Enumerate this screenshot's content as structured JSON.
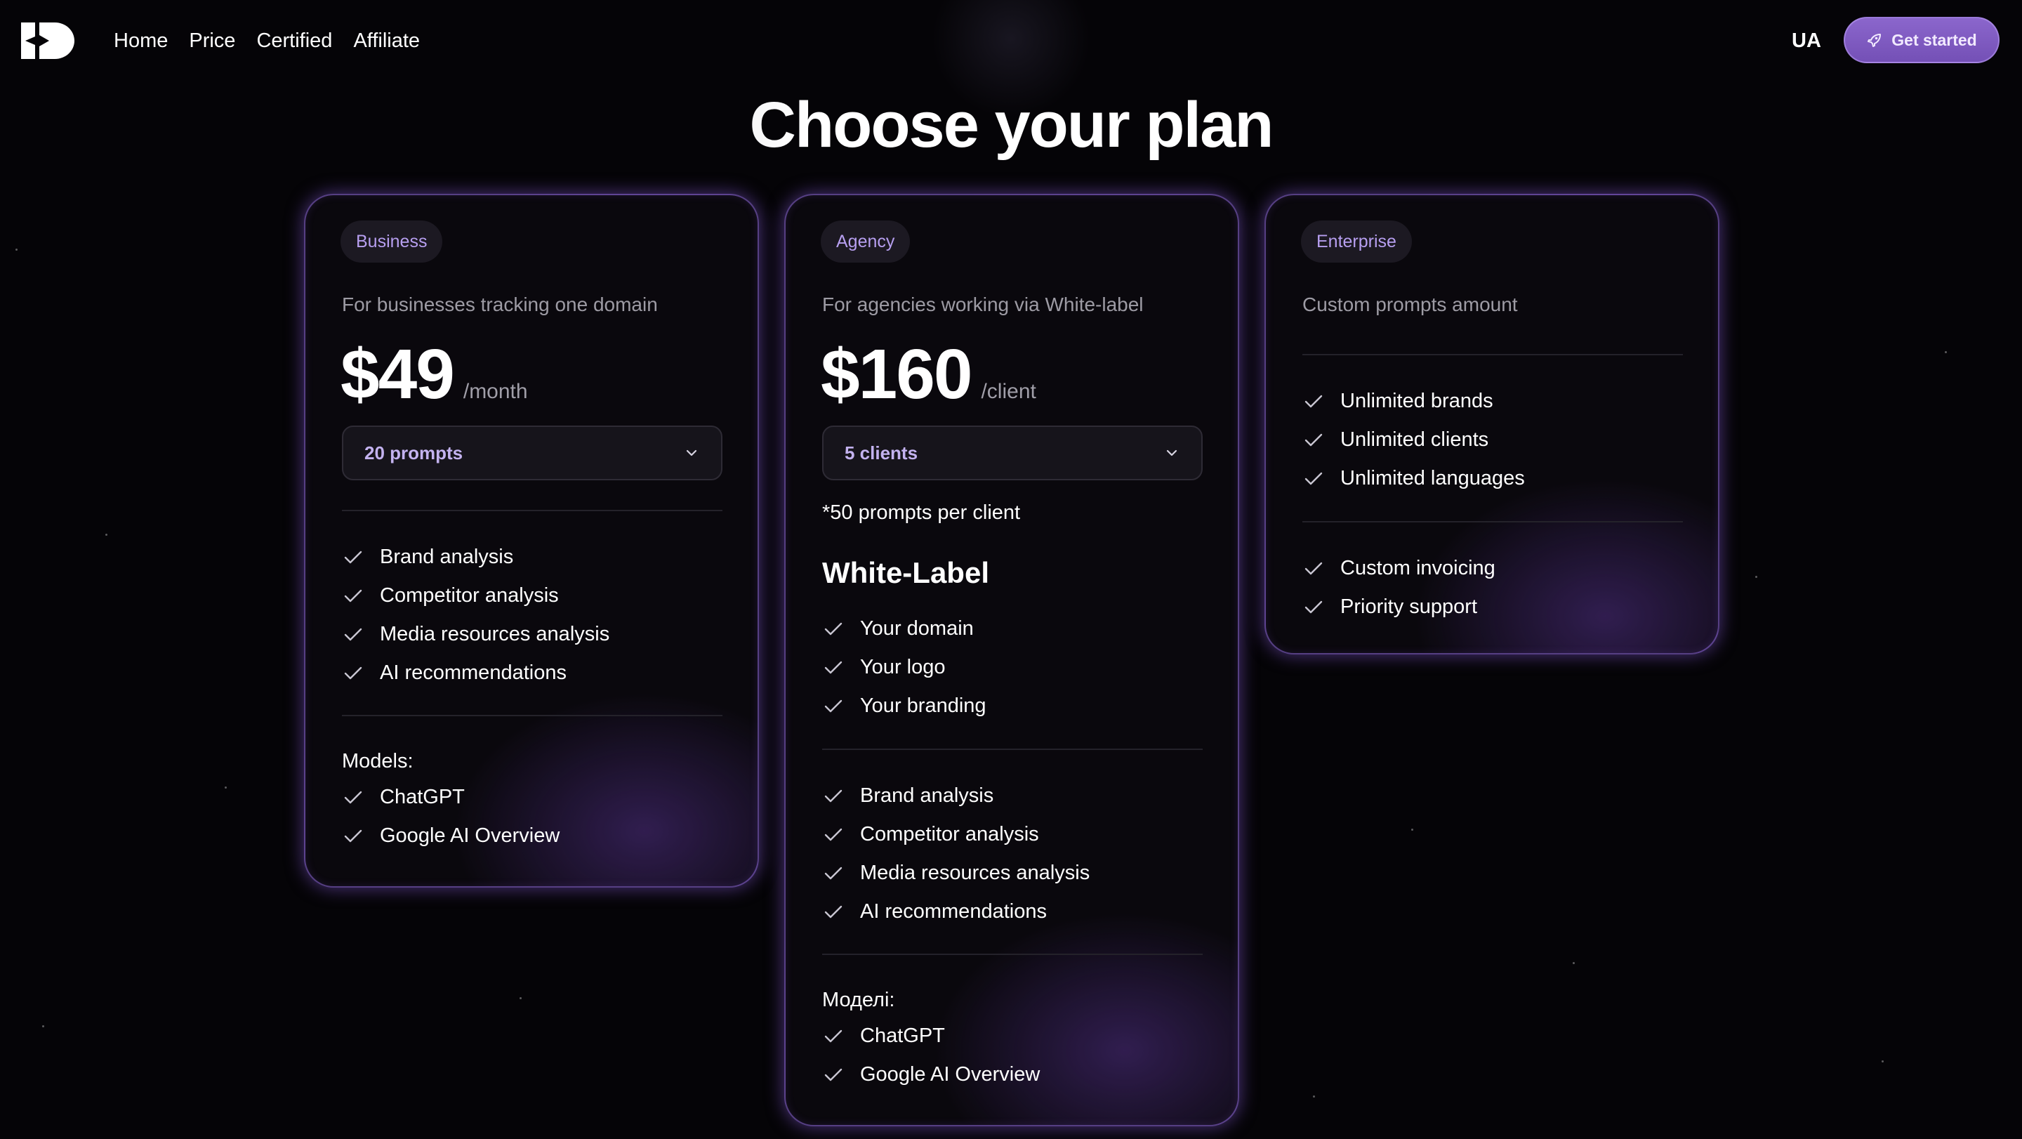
{
  "nav": {
    "links": [
      "Home",
      "Price",
      "Certified",
      "Affiliate"
    ],
    "lang": "UA",
    "cta_label": "Get started"
  },
  "page": {
    "title": "Choose your plan"
  },
  "colors": {
    "accent": "#8b66cc",
    "badge_text": "#b79ff0",
    "card_glow": "#8c5fe6",
    "background": "#050407"
  },
  "plans": {
    "business": {
      "badge": "Business",
      "subtitle": "For businesses tracking one domain",
      "price": "$49",
      "period": "/month",
      "select_value": "20 prompts",
      "features": [
        "Brand analysis",
        "Competitor analysis",
        "Media resources analysis",
        "AI recommendations"
      ],
      "models_label": "Models:",
      "models": [
        "ChatGPT",
        "Google AI Overview"
      ]
    },
    "agency": {
      "badge": "Agency",
      "subtitle": "For agencies working via White-label",
      "price": "$160",
      "period": "/client",
      "select_value": "5 clients",
      "note": "*50 prompts per client",
      "whitelabel_title": "White-Label",
      "whitelabel": [
        "Your domain",
        "Your logo",
        "Your branding"
      ],
      "features": [
        "Brand analysis",
        "Competitor analysis",
        "Media resources analysis",
        "AI recommendations"
      ],
      "models_label": "Моделі:",
      "models": [
        "ChatGPT",
        "Google AI Overview"
      ]
    },
    "enterprise": {
      "badge": "Enterprise",
      "subtitle": "Custom prompts amount",
      "features": [
        "Unlimited brands",
        "Unlimited clients",
        "Unlimited languages"
      ],
      "extras": [
        "Custom invoicing",
        "Priority support"
      ]
    }
  }
}
